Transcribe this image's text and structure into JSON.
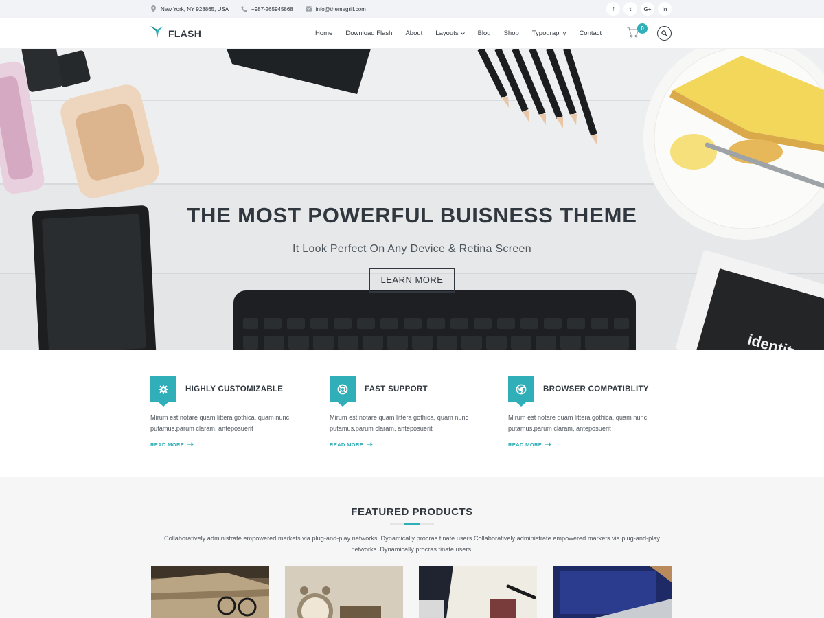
{
  "colors": {
    "accent": "#30afb8",
    "dark": "#30373e",
    "topbar_bg": "#f1f3f6",
    "products_bg": "#f6f6f6"
  },
  "topbar": {
    "address": "New York, NY 928865, USA",
    "phone": "+987-265945868",
    "email": "info@themegrill.com",
    "address_icon": "map-pin-icon",
    "phone_icon": "phone-icon",
    "email_icon": "envelope-icon",
    "social": [
      {
        "label": "f",
        "icon": "facebook-icon"
      },
      {
        "label": "t",
        "icon": "twitter-icon"
      },
      {
        "label": "G+",
        "icon": "google-plus-icon"
      },
      {
        "label": "in",
        "icon": "linkedin-icon"
      }
    ]
  },
  "header": {
    "logo_text": "FLASH",
    "nav": [
      "Home",
      "Download Flash",
      "About",
      "Layouts",
      "Blog",
      "Shop",
      "Typography",
      "Contact"
    ],
    "cart_count": "0"
  },
  "hero": {
    "title": "THE MOST POWERFUL BUISNESS THEME",
    "subtitle": "It Look Perfect On Any Device & Retina Screen",
    "button": "LEARN MORE"
  },
  "features": [
    {
      "icon": "gear-icon",
      "title": "HIGHLY CUSTOMIZABLE",
      "text": "Mirum est notare quam littera gothica, quam nunc putamus.parum claram, anteposuerit",
      "link": "READ MORE"
    },
    {
      "icon": "lifebuoy-icon",
      "title": "FAST SUPPORT",
      "text": "Mirum est notare quam littera gothica, quam nunc putamus.parum claram, anteposuerit",
      "link": "READ MORE"
    },
    {
      "icon": "chrome-icon",
      "title": "BROWSER COMPATIBLITY",
      "text": "Mirum est notare quam littera gothica, quam nunc putamus.parum claram, anteposuerit",
      "link": "READ MORE"
    }
  ],
  "products": {
    "title": "FEATURED PRODUCTS",
    "description": "Collaboratively administrate empowered markets via plug-and-play networks. Dynamically procras tinate users.Collaboratively administrate empowered markets via plug-and-play networks. Dynamically procras tinate users."
  }
}
